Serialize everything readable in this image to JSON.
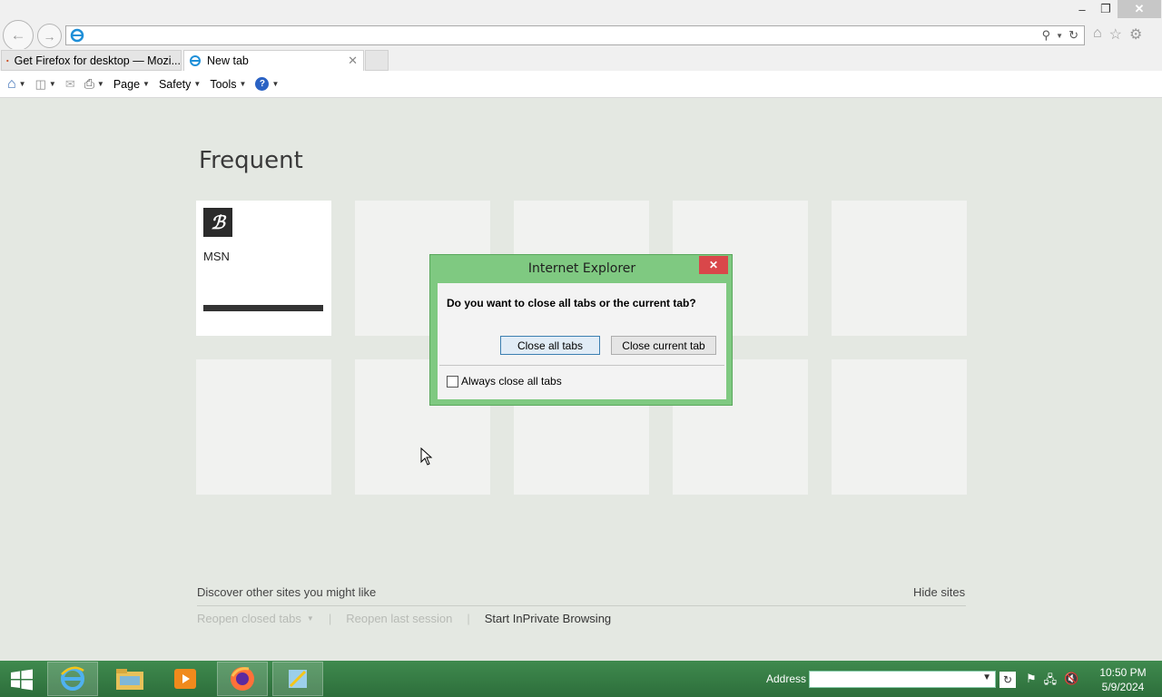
{
  "browser": {
    "address_value": "",
    "tabs": [
      {
        "title": "Get Firefox for desktop — Mozi...",
        "icon": "firefox-icon"
      },
      {
        "title": "New tab",
        "icon": "ie-icon"
      }
    ],
    "commands": {
      "page": "Page",
      "safety": "Safety",
      "tools": "Tools"
    }
  },
  "new_tab_page": {
    "frequent_title": "Frequent",
    "tiles": [
      {
        "label": "MSN"
      }
    ],
    "discover_text": "Discover other sites you might like",
    "hide_sites": "Hide sites",
    "footer": {
      "reopen_closed_tabs": "Reopen closed tabs",
      "reopen_last_session": "Reopen last session",
      "start_inprivate": "Start InPrivate Browsing"
    }
  },
  "dialog": {
    "title": "Internet Explorer",
    "question": "Do you want to close all tabs or the current tab?",
    "close_all_label": "Close all tabs",
    "close_current_label": "Close current tab",
    "always_close_label": "Always close all tabs",
    "always_close_checked": false
  },
  "taskbar": {
    "address_label": "Address",
    "address_value": "",
    "time": "10:50 PM",
    "date": "5/9/2024"
  },
  "colors": {
    "dialog_frame": "#7fc981",
    "taskbar": "#3f8a4e",
    "close_red": "#d9474a"
  }
}
